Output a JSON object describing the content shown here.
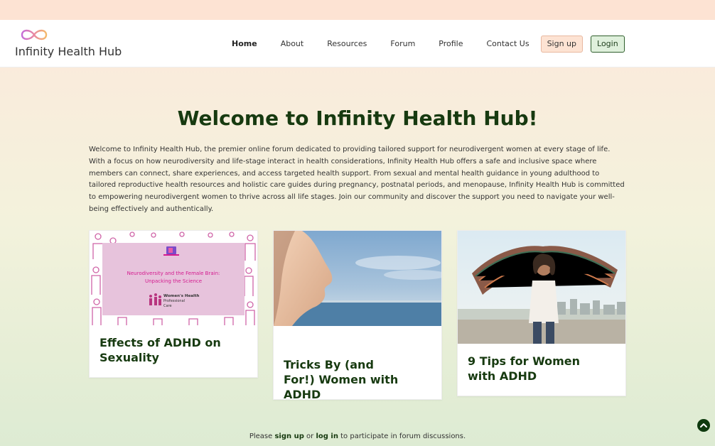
{
  "brand": {
    "name": "Infinity Health Hub",
    "logo_icon": "infinity-icon"
  },
  "nav": {
    "links": [
      "Home",
      "About",
      "Resources",
      "Forum",
      "Profile",
      "Contact Us"
    ],
    "signup_label": "Sign up",
    "login_label": "Login"
  },
  "hero": {
    "title": "Welcome to Infinity Health Hub!",
    "intro": "Welcome to Infinity Health Hub, the premier online forum dedicated to providing tailored support for neurodivergent women at every stage of life. With a focus on how neurodiversity and life-stage interact in health considerations, Infinity Health Hub offers a safe and inclusive space where members can connect, share experiences, and access targeted health support. From sexual and mental health guidance in young adulthood to tailored reproductive health resources and holistic care guides during pregnancy, postnatal periods, and menopause, Infinity Health Hub is committed to empowering neurodivergent women to thrive across all life stages. Join our community and discover the support you need to navigate your well-being effectively and authentically."
  },
  "cards": [
    {
      "title": "Effects of ADHD on Sexuality",
      "image_text": {
        "headline_1": "Neurodiversity and the Female Brain:",
        "headline_2": "Unpacking the Science",
        "org_1": "Women's Health",
        "org_2": "Professional",
        "org_3": "Care"
      }
    },
    {
      "title": "Tricks By (and For!) Women with ADHD"
    },
    {
      "title": "9 Tips for Women with ADHD"
    }
  ],
  "footer": {
    "before": "Please ",
    "signup_link": "sign up",
    "middle": " or ",
    "login_link": "log in",
    "after": " to participate in forum discussions."
  },
  "colors": {
    "heading_green": "#173a10",
    "signup_bg": "#fde3d3",
    "login_bg": "#dff0dc",
    "card1_bg": "#e7c3dc",
    "card1_accent": "#d41b8f"
  }
}
